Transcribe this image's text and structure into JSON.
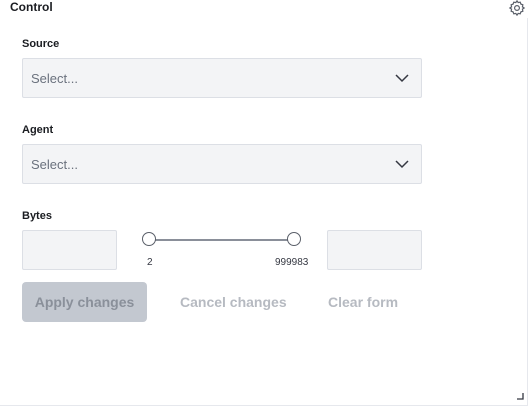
{
  "panel": {
    "title": "Control",
    "settings_icon": "gear-icon"
  },
  "fields": {
    "source": {
      "label": "Source",
      "placeholder": "Select..."
    },
    "agent": {
      "label": "Agent",
      "placeholder": "Select..."
    },
    "bytes": {
      "label": "Bytes",
      "min_label": "2",
      "max_label": "999983",
      "min_value": "",
      "max_value": ""
    }
  },
  "buttons": {
    "apply": "Apply changes",
    "cancel": "Cancel changes",
    "clear": "Clear form"
  },
  "colors": {
    "input_bg": "#f3f4f6",
    "disabled_button": "#c3c8d0",
    "disabled_text": "#b6bac1"
  }
}
